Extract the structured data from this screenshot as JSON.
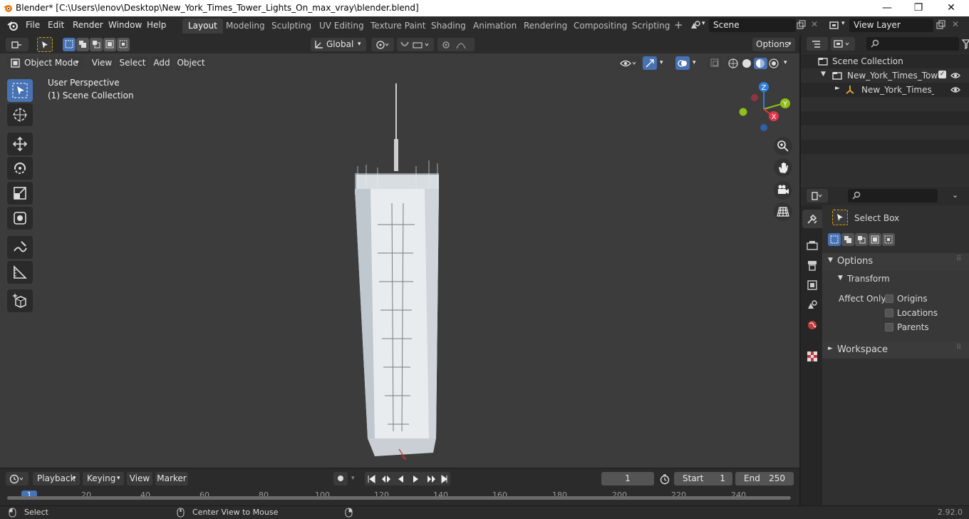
{
  "window": {
    "title": "Blender* [C:\\Users\\lenov\\Desktop\\New_York_Times_Tower_Lights_On_max_vray\\blender.blend]",
    "controls": [
      "—",
      "❐",
      "✕"
    ]
  },
  "menu": [
    "File",
    "Edit",
    "Render",
    "Window",
    "Help"
  ],
  "workspaces": [
    "Layout",
    "Modeling",
    "Sculpting",
    "UV Editing",
    "Texture Paint",
    "Shading",
    "Animation",
    "Rendering",
    "Compositing",
    "Scripting"
  ],
  "active_workspace": "Layout",
  "scene": {
    "name": "Scene",
    "view_layer": "View Layer"
  },
  "tool_header": {
    "orientation": "Global",
    "options_label": "Options"
  },
  "viewport_header": {
    "mode": "Object Mode",
    "menus": [
      "View",
      "Select",
      "Add",
      "Object"
    ]
  },
  "viewport": {
    "perspective": "User Perspective",
    "collection": "(1) Scene Collection",
    "axes": {
      "z": "Z",
      "y": "Y",
      "x": "X"
    }
  },
  "tools": [
    "select-box-icon",
    "cursor-icon",
    "move-icon",
    "rotate-icon",
    "scale-icon",
    "transform-icon",
    "annotate-icon",
    "measure-icon",
    "add-cube-icon"
  ],
  "outliner": {
    "root": "Scene Collection",
    "items": [
      {
        "label": "New_York_Times_Tower_",
        "level": 1
      },
      {
        "label": "New_York_Times_Tow",
        "level": 2
      }
    ]
  },
  "properties": {
    "active_tool": "Select Box",
    "options_label": "Options",
    "transform_label": "Transform",
    "affect_only_label": "Affect Only",
    "checks": [
      "Origins",
      "Locations",
      "Parents"
    ],
    "workspace_label": "Workspace"
  },
  "timeline": {
    "menus": [
      "Playback",
      "Keying",
      "View",
      "Marker"
    ],
    "current_frame": "1",
    "start_label": "Start",
    "start_value": "1",
    "end_label": "End",
    "end_value": "250",
    "ruler": [
      "1",
      "20",
      "40",
      "60",
      "80",
      "100",
      "120",
      "140",
      "160",
      "180",
      "200",
      "220",
      "240"
    ]
  },
  "status": {
    "left": "Select",
    "middle": "Center View to Mouse",
    "version": "2.92.0"
  },
  "colors": {
    "accent": "#4772b3",
    "viewport_bg": "#3c3c3c",
    "panel_bg": "#303030",
    "header_bg": "#2b2b2b"
  }
}
